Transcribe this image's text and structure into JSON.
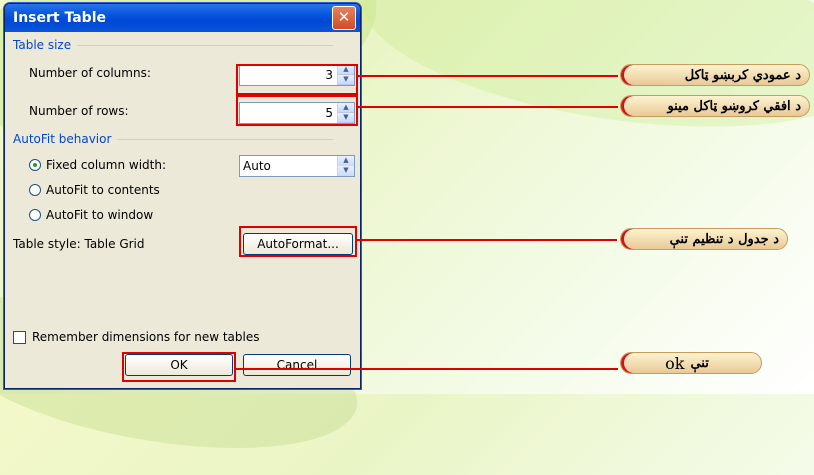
{
  "dialog": {
    "title": "Insert Table",
    "close_label": "✕",
    "table_size": {
      "heading": "Table size",
      "columns_label": "Number of columns:",
      "columns_value": "3",
      "rows_label": "Number of rows:",
      "rows_value": "5"
    },
    "autofit": {
      "heading": "AutoFit behavior",
      "fixed_label": "Fixed column width:",
      "fixed_value": "Auto",
      "contents_label": "AutoFit to contents",
      "window_label": "AutoFit to window",
      "selected": "fixed"
    },
    "style_text": "Table style: Table Grid",
    "autoformat_label": "AutoFormat...",
    "remember_label": "Remember dimensions for new tables",
    "remember_checked": false,
    "ok_label": "OK",
    "cancel_label": "Cancel"
  },
  "callouts": {
    "columns": "د عمودي کربښو ټاکل",
    "rows": "د افقي کروښو ټاکل مینو",
    "style": "د جدول د تنظیم تنې",
    "ok_text": "تنې",
    "ok_latin": "ok"
  },
  "colors": {
    "title_bar": "#0a55d8",
    "dialog_bg": "#ece9d8",
    "highlight": "#e00000",
    "group_heading": "#0046d5"
  }
}
